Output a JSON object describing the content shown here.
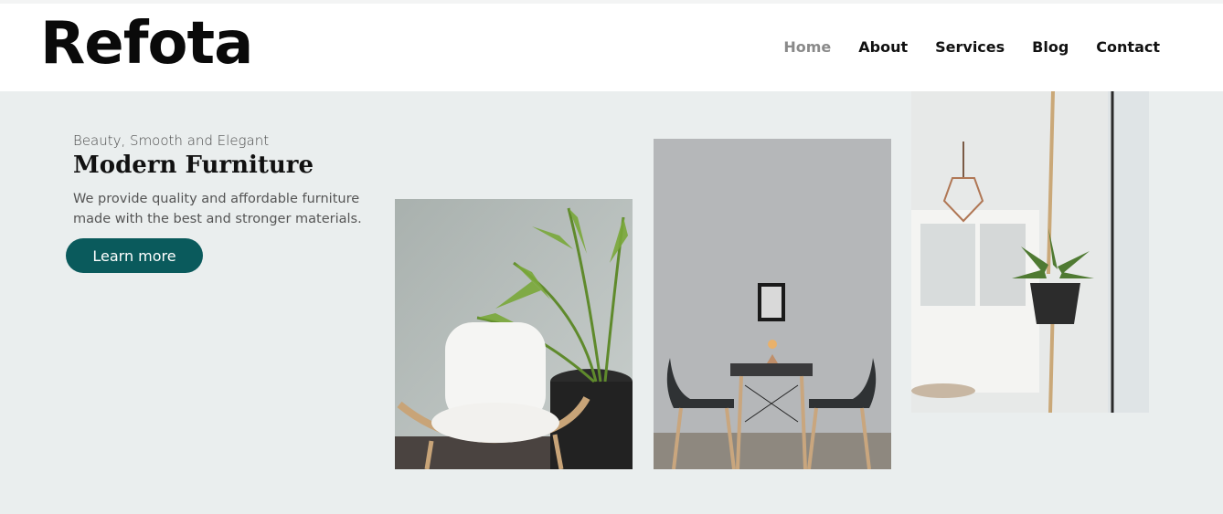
{
  "brand": {
    "logo": "Refota"
  },
  "nav": {
    "items": [
      {
        "label": "Home",
        "active": true
      },
      {
        "label": "About"
      },
      {
        "label": "Services"
      },
      {
        "label": "Blog"
      },
      {
        "label": "Contact"
      }
    ]
  },
  "hero": {
    "tagline": "Beauty, Smooth and Elegant",
    "title": "Modern Furniture",
    "description": "We provide quality and affordable furniture made with the best and stronger materials.",
    "cta_label": "Learn more"
  },
  "gallery": {
    "items": [
      {
        "icon": "lounge-chair-plant-image"
      },
      {
        "icon": "dining-table-chairs-image"
      },
      {
        "icon": "hanging-planter-image"
      }
    ]
  },
  "colors": {
    "accent": "#0a5a5c",
    "hero_bg": "#eaeeee",
    "nav_active": "#8a8a8a"
  }
}
